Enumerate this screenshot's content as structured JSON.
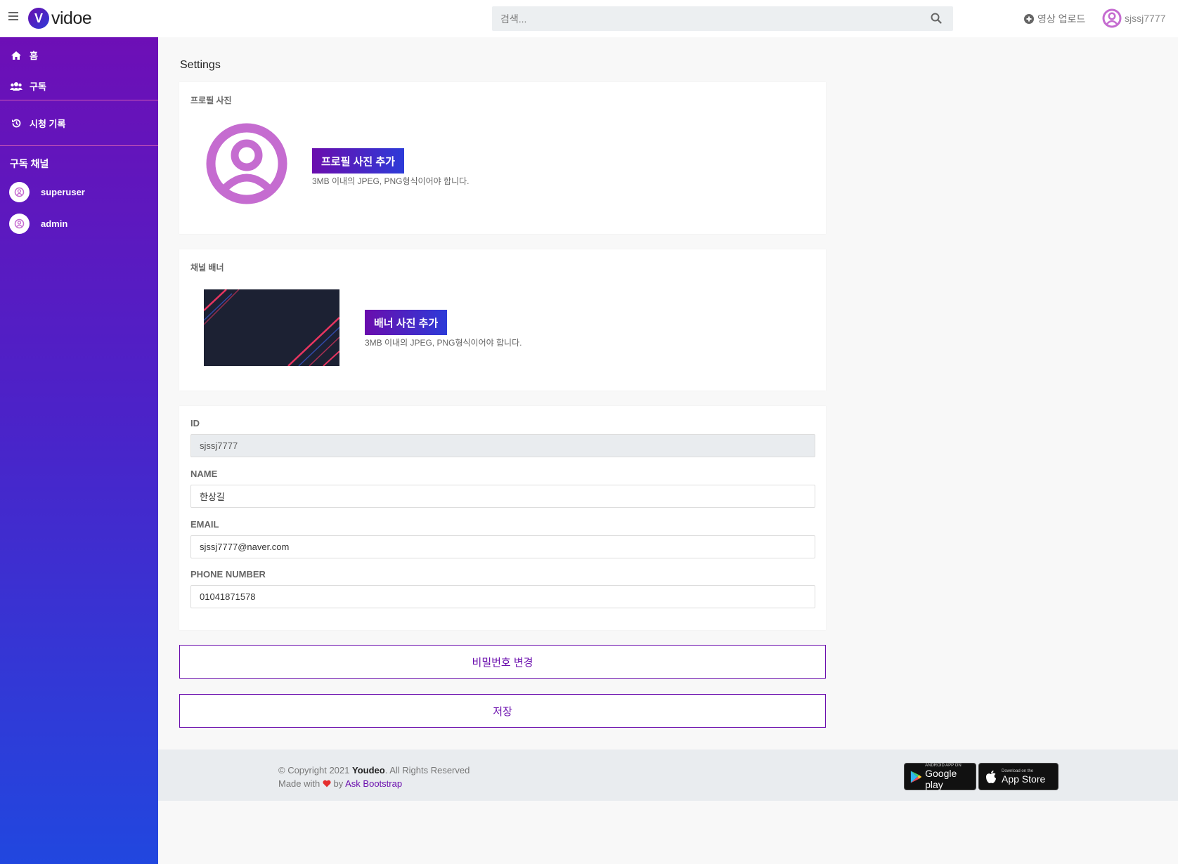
{
  "header": {
    "logo_letter": "V",
    "logo_text": "vidoe",
    "search_placeholder": "검색...",
    "upload_label": "영상 업로드",
    "username": "sjssj7777"
  },
  "sidebar": {
    "items": [
      {
        "label": "홈",
        "icon": "home-icon"
      },
      {
        "label": "구독",
        "icon": "users-icon"
      },
      {
        "label": "시청 기록",
        "icon": "history-icon"
      }
    ],
    "channels_heading": "구독 채널",
    "channels": [
      {
        "name": "superuser",
        "icon": "user-circle-icon"
      },
      {
        "name": "admin",
        "icon": "user-circle-icon"
      }
    ]
  },
  "main": {
    "title": "Settings",
    "profile": {
      "label": "프로필 사진",
      "button": "프로필 사진 추가",
      "hint": "3MB 이내의 JPEG, PNG형식이어야 합니다."
    },
    "banner": {
      "label": "채널 배너",
      "button": "배너 사진 추가",
      "hint": "3MB 이내의 JPEG, PNG형식이어야 합니다."
    },
    "form": {
      "id_label": "ID",
      "id_value": "sjssj7777",
      "name_label": "NAME",
      "name_value": "한상길",
      "email_label": "EMAIL",
      "email_value": "sjssj7777@naver.com",
      "phone_label": "PHONE NUMBER",
      "phone_value": "01041871578"
    },
    "change_password": "비밀번호 변경",
    "save": "저장"
  },
  "footer": {
    "copyright_prefix": "© Copyright 2021",
    "brand": "Youdeo",
    "rights": ". All Rights Reserved",
    "made_with": "Made with",
    "by": "by",
    "link": "Ask Bootstrap",
    "google_small": "ANDROID APP ON",
    "google_big": "Google play",
    "apple_small": "Download on the",
    "apple_big": "App Store"
  },
  "colors": {
    "accent_purple": "#6a0dad",
    "accent_blue": "#2d3bd8",
    "avatar_pink": "#c56cd0"
  }
}
